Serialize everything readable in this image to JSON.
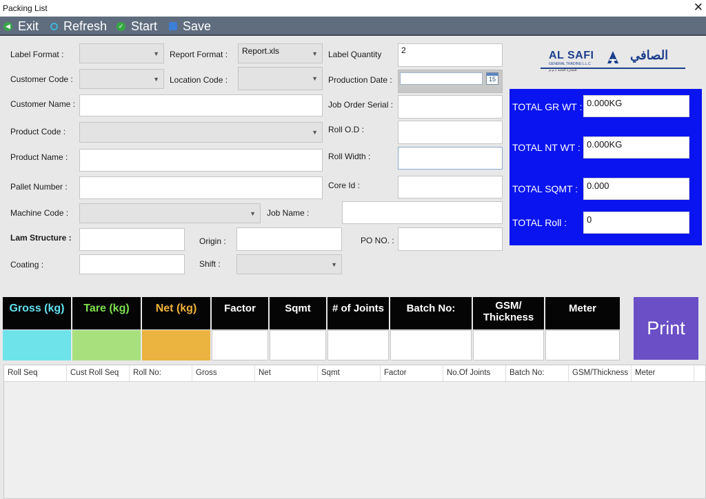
{
  "window": {
    "title": "Packing List",
    "close_glyph": "✕"
  },
  "toolbar": {
    "exit": "Exit",
    "refresh": "Refresh",
    "start": "Start",
    "save": "Save"
  },
  "form": {
    "label_format": "Label Format :",
    "report_format": "Report Format :",
    "report_format_value": "Report.xls",
    "label_quantity": "Label Quantity",
    "label_quantity_value": "2",
    "customer_code": "Customer Code :",
    "location_code": "Location Code :",
    "production_date": "Production Date :",
    "calendar_day": "15",
    "customer_name": "Customer Name :",
    "job_order_serial": "Job Order Serial :",
    "product_code": "Product Code :",
    "roll_od": "Roll O.D :",
    "product_name": "Product Name :",
    "roll_width": "Roll Width  :",
    "pallet_number": "Pallet Number  :",
    "core_id": "Core Id :",
    "machine_code": "Machine Code :",
    "job_name": "Job Name :",
    "lam_structure": "Lam Structure :",
    "origin": "Origin :",
    "po_no": "PO NO. :",
    "coating": "Coating :",
    "shift": "Shift :"
  },
  "logo": {
    "name_en": "AL SAFI",
    "name_ar": "الصافي",
    "sub_en": "GENERAL TRADING L.L.C",
    "sub_ar": "للتجارة العامة ذ.م.م"
  },
  "totals": {
    "gross_label": "TOTAL GR WT :",
    "gross_value": "0.000KG",
    "net_label": "TOTAL NT WT :",
    "net_value": "0.000KG",
    "sqmt_label": "TOTAL SQMT :",
    "sqmt_value": "0.000",
    "roll_label": "TOTAL Roll :",
    "roll_value": "0"
  },
  "entry": {
    "gross": "Gross (kg)",
    "tare": "Tare (kg)",
    "net": "Net (kg)",
    "factor": "Factor",
    "sqmt": "Sqmt",
    "joints": "# of Joints",
    "batch": "Batch No:",
    "gsm": "GSM/ Thickness",
    "meter": "Meter",
    "print": "Print"
  },
  "grid": {
    "columns": [
      "Roll Seq",
      "Cust Roll Seq",
      "Roll No:",
      "Gross",
      "Net",
      "Sqmt",
      "Factor",
      "No.Of Joints",
      "Batch No:",
      "GSM/Thickness",
      "Meter"
    ]
  },
  "colors": {
    "toolbar": "#5f6d7e",
    "totals_panel": "#0a14f0",
    "gross_cell": "#6fe3ea",
    "tare_cell": "#a8e07e",
    "net_cell": "#ebb33f",
    "gross_text": "#62e0f0",
    "tare_text": "#7ee04e",
    "net_text": "#f0b23a",
    "print_button": "#6a4fc7"
  }
}
